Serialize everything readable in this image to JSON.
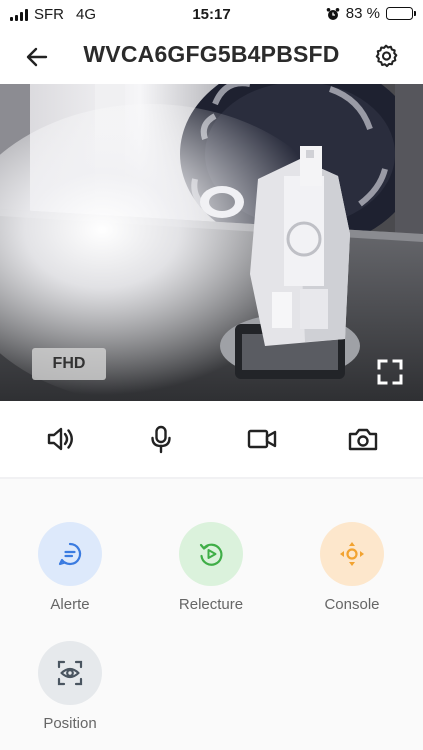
{
  "status_bar": {
    "carrier": "SFR",
    "network": "4G",
    "time": "15:17",
    "battery": "83 %",
    "battery_level": 0.83
  },
  "header": {
    "title": "WVCA6GFG5B4PBSFD",
    "back_icon": "arrow-left-icon",
    "settings_icon": "gear-icon"
  },
  "video": {
    "quality_label": "FHD",
    "fullscreen_icon": "fullscreen-icon"
  },
  "controls": [
    {
      "name": "speaker",
      "icon": "speaker-icon"
    },
    {
      "name": "microphone",
      "icon": "microphone-icon"
    },
    {
      "name": "record",
      "icon": "video-camera-icon"
    },
    {
      "name": "snapshot",
      "icon": "camera-icon"
    }
  ],
  "features": [
    {
      "label": "Alerte",
      "icon": "message-icon",
      "bg": "#dde9fb",
      "color": "#3a7be0"
    },
    {
      "label": "Relecture",
      "icon": "replay-icon",
      "bg": "#dbf2dc",
      "color": "#3fae47"
    },
    {
      "label": "Console",
      "icon": "direction-pad-icon",
      "bg": "#fde7cc",
      "color": "#f2a330"
    },
    {
      "label": "Position",
      "icon": "eye-focus-icon",
      "bg": "#e6e9ec",
      "color": "#4a5560"
    }
  ]
}
